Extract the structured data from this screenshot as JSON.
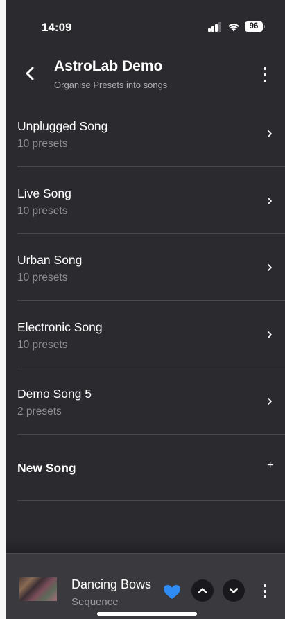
{
  "status_bar": {
    "time": "14:09",
    "battery": "96"
  },
  "header": {
    "title": "AstroLab Demo",
    "subtitle": "Organise Presets into songs"
  },
  "songs": [
    {
      "name": "Unplugged Song",
      "count": "10 presets"
    },
    {
      "name": "Live Song",
      "count": "10 presets"
    },
    {
      "name": "Urban Song",
      "count": "10 presets"
    },
    {
      "name": "Electronic Song",
      "count": "10 presets"
    },
    {
      "name": "Demo Song 5",
      "count": "2 presets"
    }
  ],
  "new_song": {
    "label": "New Song",
    "icon": "+"
  },
  "player": {
    "track": "Dancing Bows",
    "subtitle": "Sequence",
    "favorite_color": "#2f8cf5"
  },
  "icons": {
    "back": "chevron-left-icon",
    "menu": "more-vertical-icon",
    "row": "chevron-right-icon",
    "favorite": "heart-icon",
    "up": "chevron-up-icon",
    "down": "chevron-down-icon"
  }
}
